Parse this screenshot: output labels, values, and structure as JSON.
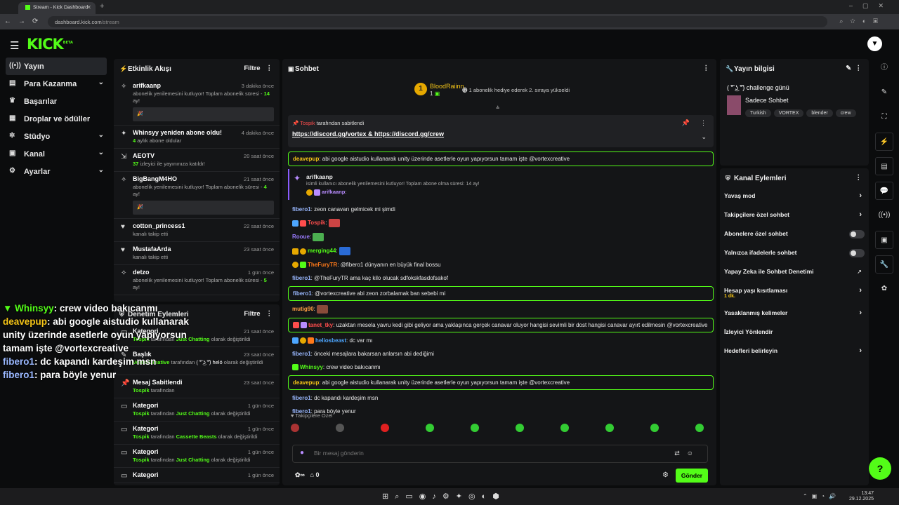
{
  "browser": {
    "tab_title": "Stream - Kick Dashboard",
    "url_host": "dashboard.kick.com",
    "url_path": "/stream"
  },
  "brand": {
    "logo": "KICK",
    "beta": "BETA"
  },
  "nav": [
    {
      "label": "Yayın",
      "icon": "broadcast-icon"
    },
    {
      "label": "Para Kazanma",
      "icon": "wallet-icon"
    },
    {
      "label": "Başarılar",
      "icon": "trophy-icon"
    },
    {
      "label": "Droplar ve ödüller",
      "icon": "gift-icon"
    },
    {
      "label": "Stüdyo",
      "icon": "gear-icon"
    },
    {
      "label": "Kanal",
      "icon": "users-icon"
    },
    {
      "label": "Ayarlar",
      "icon": "gear-icon"
    }
  ],
  "activity": {
    "title": "Etkinlik Akışı",
    "filter": "Filtre",
    "items": [
      {
        "name": "arifkaanp",
        "time": "3 dakika önce",
        "desc": "abonelik yenilemesini kutluyor! Toplam abonelik süresi -",
        "highlight": "14",
        "suffix": "ay!"
      },
      {
        "name": "Whinsyy yeniden abone oldu!",
        "time": "4 dakika önce",
        "highlight": "4",
        "desc": "aylık abone oldular"
      },
      {
        "name": "AEOTV",
        "time": "20 saat önce",
        "highlight": "37",
        "desc": "izleyici ile yayınınıza katıldı!"
      },
      {
        "name": "BigBangM4HO",
        "time": "21 saat önce",
        "desc": "abonelik yenilemesini kutluyor! Toplam abonelik süresi -",
        "highlight": "4",
        "suffix": "ay!"
      },
      {
        "name": "cotton_princess1",
        "time": "22 saat önce",
        "desc": "kanalı takip etti"
      },
      {
        "name": "MustafaArda",
        "time": "23 saat önce",
        "desc": "kanalı takip etti"
      },
      {
        "name": "detzo",
        "time": "1 gün önce",
        "desc": "abonelik yenilemesini kutluyor! Toplam abonelik süresi -",
        "highlight": "5",
        "suffix": "ay!"
      }
    ]
  },
  "moderation": {
    "title": "Denetim Eylemleri",
    "filter": "Filtre",
    "items": [
      {
        "name": "Kategori",
        "time": "21 saat önce",
        "user": "Tospik",
        "mid": "tarafından",
        "cat": "Just Chatting",
        "end": "olarak değiştirildi"
      },
      {
        "name": "Başlık",
        "time": "23 saat önce",
        "user": "VortexCreative",
        "mid": "tarafından",
        "cat": "( ͡° ͜ʖ ͡°) helö",
        "end": "olarak değiştirildi"
      },
      {
        "name": "Mesaj Sabitlendi",
        "time": "23 saat önce",
        "user": "Tospik",
        "mid": "tarafından",
        "cat": "",
        "end": ""
      },
      {
        "name": "Kategori",
        "time": "1 gün önce",
        "user": "Tospik",
        "mid": "tarafından",
        "cat": "Just Chatting",
        "end": "olarak değiştirildi"
      },
      {
        "name": "Kategori",
        "time": "1 gün önce",
        "user": "Tospik",
        "mid": "tarafından",
        "cat": "Cassette Beasts",
        "end": "olarak değiştirildi"
      },
      {
        "name": "Kategori",
        "time": "1 gün önce",
        "user": "Tospik",
        "mid": "tarafından",
        "cat": "Just Chatting",
        "end": "olarak değiştirildi"
      },
      {
        "name": "Kategori",
        "time": "1 gün önce",
        "user": "",
        "mid": "",
        "cat": "",
        "end": ""
      }
    ]
  },
  "chat": {
    "title": "Sohbet",
    "top_gifter": {
      "rank": "1",
      "name": "BloodRaiinn",
      "count": "1",
      "desc": "1 abonelik hediye ederek 2. sıraya yükseldi"
    },
    "pinned": {
      "by": "Tospik",
      "by_suffix": "tarafından sabitlendi",
      "link1": "https://discord.gg/vortex",
      "amp": "&",
      "link2": "https://discord.gg/crew"
    },
    "messages": [
      {
        "user": "deavepup",
        "color": "#f5c518",
        "text": "abi google aistudio kullanarak unity üzerinde asetlerle oyun yapıyorsun tamam işte @vortexcreative",
        "hl": true
      },
      {
        "user": "fibero1",
        "color": "#9ab8ff",
        "text": "zeon canavarı gelmicek mi şimdi"
      },
      {
        "user": "Tospik",
        "color": "#ff4d4d",
        "text": ""
      },
      {
        "user": "Rooue",
        "color": "#9b7bff",
        "text": ""
      },
      {
        "user": "merging44",
        "color": "#53fc18",
        "text": ""
      },
      {
        "user": "TheFuryTR",
        "color": "#ff7a1a",
        "text": "@fibero1 dünyanın en büyük final bossu"
      },
      {
        "user": "fibero1",
        "color": "#9ab8ff",
        "text": "@TheFuryTR ama kaç kilo olucak sdfokskfasdofsakof"
      },
      {
        "user": "fibero1",
        "color": "#9ab8ff",
        "text": "@vortexcreative abi zeon zorbalamak ban sebebi mi",
        "hl": true
      },
      {
        "user": "mutig90",
        "color": "#ff9f43",
        "text": ""
      },
      {
        "user": "tanet_tky",
        "color": "#ff4d4d",
        "text": "uzaktan mesela yavru kedi gibi geliyor ama yaklaşınca gerçek canavar oluyor hangisi sevimli bir dost hangisi canavar ayırt edilmesin @vortexcreative",
        "hl": true
      },
      {
        "user": "heliosbeast",
        "color": "#4da6ff",
        "text": "dc var mı"
      },
      {
        "user": "fibero1",
        "color": "#9ab8ff",
        "text": "önceki mesajlara bakarsan anlarsın abi dediğimi"
      },
      {
        "user": "Whinsyy",
        "color": "#53fc18",
        "text": "crew video bakıcanmı"
      },
      {
        "user": "deavepup",
        "color": "#f5c518",
        "text": "abi google aistudio kullanarak unity üzerinde asetlerle oyun yapıyorsun tamam işte @vortexcreative",
        "hl": true
      },
      {
        "user": "fibero1",
        "color": "#9ab8ff",
        "text": "dc kapandı kardeşim msn"
      },
      {
        "user": "fibero1",
        "color": "#9ab8ff",
        "text": "para böyle yenur"
      }
    ],
    "sub_notice": {
      "user": "arifkaanp",
      "desc": "isimli kullanıcı abonelik yenilemesini kutluyor! Toplam abone olma süresi: 14 ay!",
      "reply_user": "arifkaanp"
    },
    "followers_label": "Takipçilere Özel",
    "placeholder": "Bir mesaj gönderin",
    "points": "0",
    "send": "Gönder"
  },
  "stream_info": {
    "title": "Yayın bilgisi",
    "stream_title": "( ͡° ͜ʖ ͡°) challenge günü",
    "category": "Sadece Sohbet",
    "tags": [
      "Turkish",
      "VORTEX",
      "blender",
      "crew"
    ]
  },
  "channel_actions": {
    "title": "Kanal Eylemleri",
    "items": [
      {
        "label": "Yavaş mod",
        "kind": "chevron"
      },
      {
        "label": "Takipçilere özel sohbet",
        "kind": "chevron"
      },
      {
        "label": "Abonelere özel sohbet",
        "kind": "toggle"
      },
      {
        "label": "Yalnızca ifadelerle sohbet",
        "kind": "toggle"
      },
      {
        "label": "Yapay Zeka ile Sohbet Denetimi",
        "kind": "external"
      },
      {
        "label": "Hesap yaşı kısıtlaması",
        "sub": "1 dk.",
        "kind": "chevron"
      },
      {
        "label": "Yasaklanmış kelimeler",
        "kind": "chevron"
      },
      {
        "label": "İzleyici Yönlendir",
        "kind": "none"
      },
      {
        "label": "Hedefleri belirleyin",
        "kind": "chevron"
      }
    ]
  },
  "overlay": [
    {
      "user": "Whinsyy",
      "color": "#53fc18",
      "text": "crew video bakıcanmı"
    },
    {
      "user": "deavepup",
      "color": "#f5c518",
      "text": "abi google aistudio kullanarak unity üzerinde asetlerle oyun yapıyorsun tamam işte @vortexcreative"
    },
    {
      "user": "fibero1",
      "color": "#9ab8ff",
      "text": "dc kapandı kardeşim msn"
    },
    {
      "user": "fibero1",
      "color": "#9ab8ff",
      "text": "para böyle yenur"
    }
  ],
  "taskbar": {
    "time": "13:47",
    "date": "29.12.2025"
  },
  "colors": {
    "accent": "#53fc18",
    "panel": "#141517",
    "bg": "#0b0c0d"
  }
}
